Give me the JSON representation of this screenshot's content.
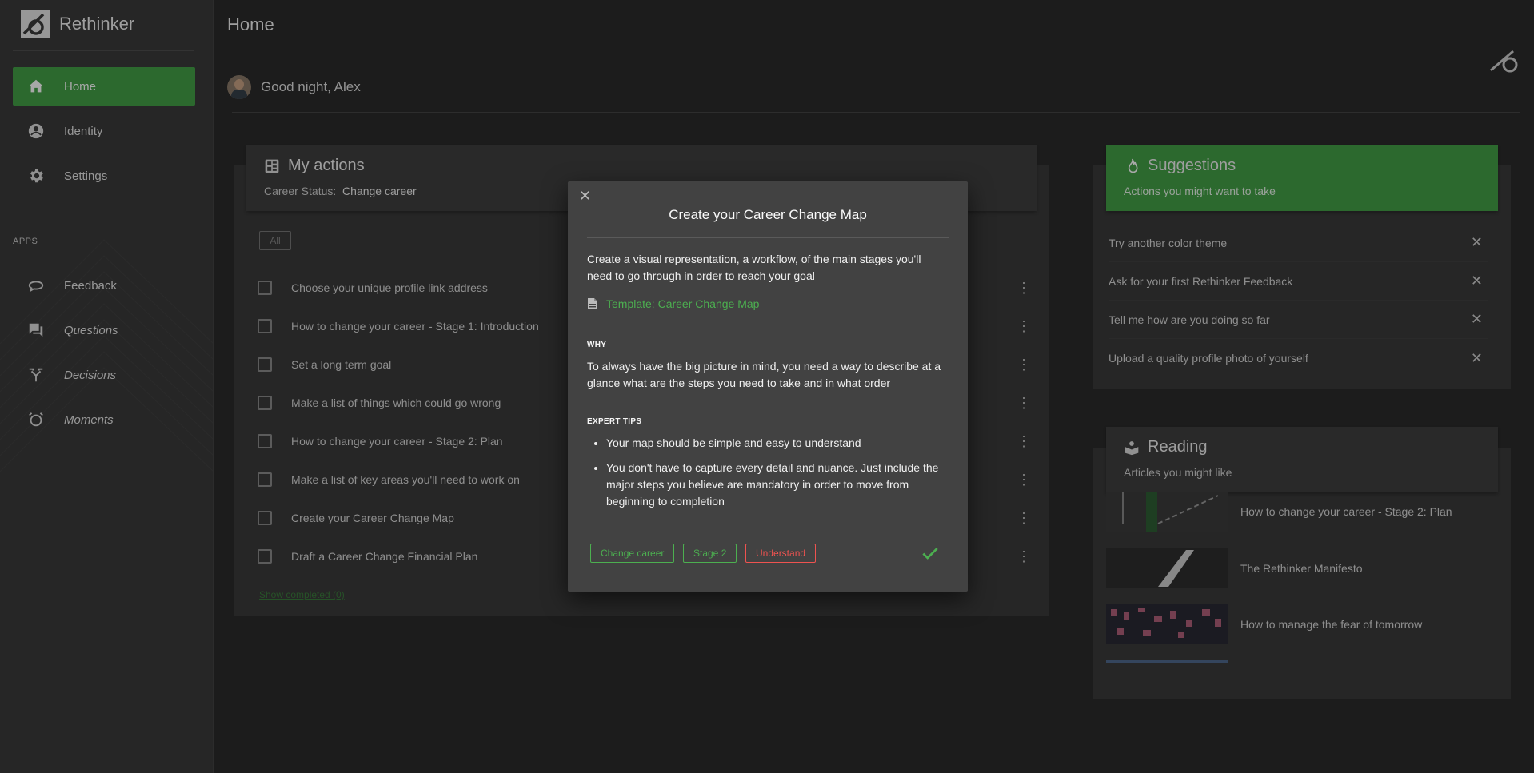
{
  "sidebar": {
    "brand": "Rethinker",
    "items": [
      {
        "label": "Home",
        "icon": "home-icon"
      },
      {
        "label": "Identity",
        "icon": "account-circle-icon"
      },
      {
        "label": "Settings",
        "icon": "gear-icon"
      }
    ],
    "apps_label": "APPS",
    "apps": [
      {
        "label": "Feedback",
        "icon": "feedback-icon"
      },
      {
        "label": "Questions",
        "icon": "forum-icon"
      },
      {
        "label": "Decisions",
        "icon": "fork-icon"
      },
      {
        "label": "Moments",
        "icon": "alarm-icon"
      }
    ]
  },
  "header": {
    "title": "Home",
    "greeting": "Good night, Alex"
  },
  "actions": {
    "title": "My actions",
    "status_label": "Career Status:",
    "status_value": "Change career",
    "filter_all": "All",
    "items": [
      "Choose your unique profile link address",
      "How to change your career - Stage 1: Introduction",
      "Set a long term goal",
      "Make a list of things which could go wrong",
      "How to change your career - Stage 2: Plan",
      "Make a list of key areas you'll need to work on",
      "Create your Career Change Map",
      "Draft a Career Change Financial Plan"
    ],
    "show_completed": "Show completed (0)"
  },
  "suggestions": {
    "title": "Suggestions",
    "subtitle": "Actions you might want to take",
    "items": [
      "Try another color theme",
      "Ask for your first Rethinker Feedback",
      "Tell me how are you doing so far",
      "Upload a quality profile photo of yourself"
    ]
  },
  "reading": {
    "title": "Reading",
    "subtitle": "Articles you might like",
    "items": [
      "How to change your career - Stage 2: Plan",
      "The Rethinker Manifesto",
      "How to manage the fear of tomorrow"
    ]
  },
  "dialog": {
    "title": "Create your Career Change Map",
    "description": "Create a visual representation, a workflow, of the main stages you'll need to go through in order to reach your goal",
    "template_link": "Template: Career Change Map",
    "why_heading": "WHY",
    "why_text": "To always have the big picture in mind, you need a way to describe at a glance what are the steps you need to take and in what order",
    "tips_heading": "EXPERT TIPS",
    "tips": [
      "Your map should be simple and easy to understand",
      "You don't have to capture every detail and nuance. Just include the major steps you believe are mandatory in order to move from beginning to completion"
    ],
    "tags": [
      "Change career",
      "Stage 2",
      "Understand"
    ]
  },
  "colors": {
    "accent_green": "#43a047",
    "tag_red": "#ef5350",
    "background": "#2b2b2b"
  }
}
